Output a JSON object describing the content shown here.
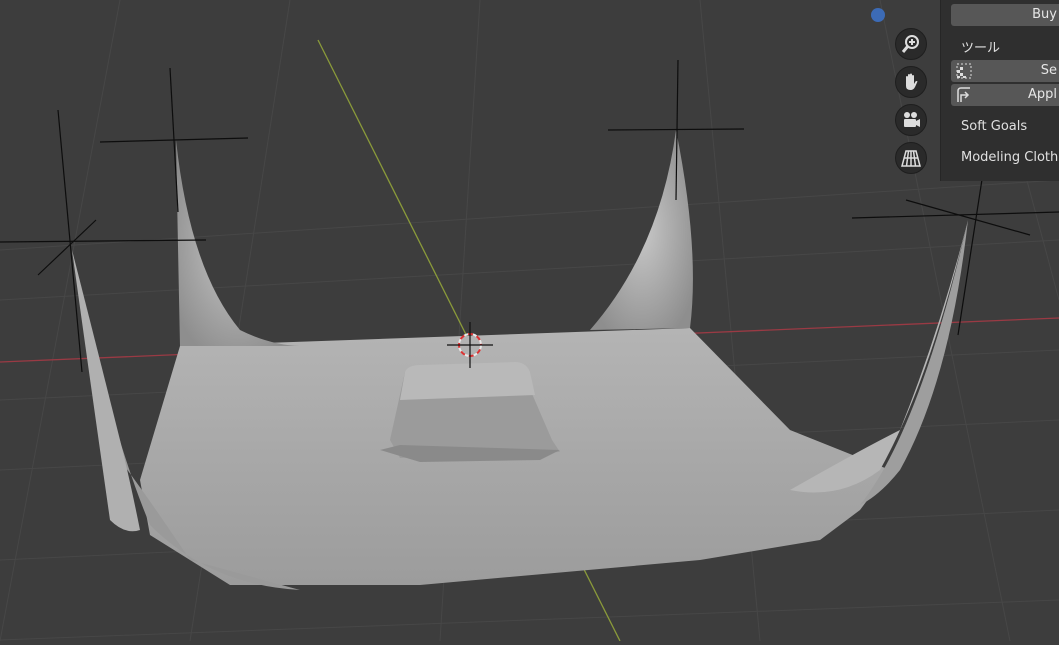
{
  "viewport": {
    "background": "#3d3d3d",
    "x_axis_color": "#9a3a44",
    "y_axis_color": "#8a9a3a",
    "mesh_color": "#a7a7a7",
    "nav_buttons": [
      {
        "name": "zoom-icon",
        "icon": "magnifier-plus"
      },
      {
        "name": "hand-icon",
        "icon": "pan-hand"
      },
      {
        "name": "camera-icon",
        "icon": "movie-camera"
      },
      {
        "name": "grid-icon",
        "icon": "perspective-grid"
      }
    ],
    "perspective_dot_color": "#3c6bb6"
  },
  "panel": {
    "buy_label": "Buy",
    "section_title": "ツール",
    "set_label": "Se",
    "apply_label": "Appl",
    "item_soft_goals": "Soft Goals",
    "item_modeling_cloth": "Modeling Cloth"
  }
}
